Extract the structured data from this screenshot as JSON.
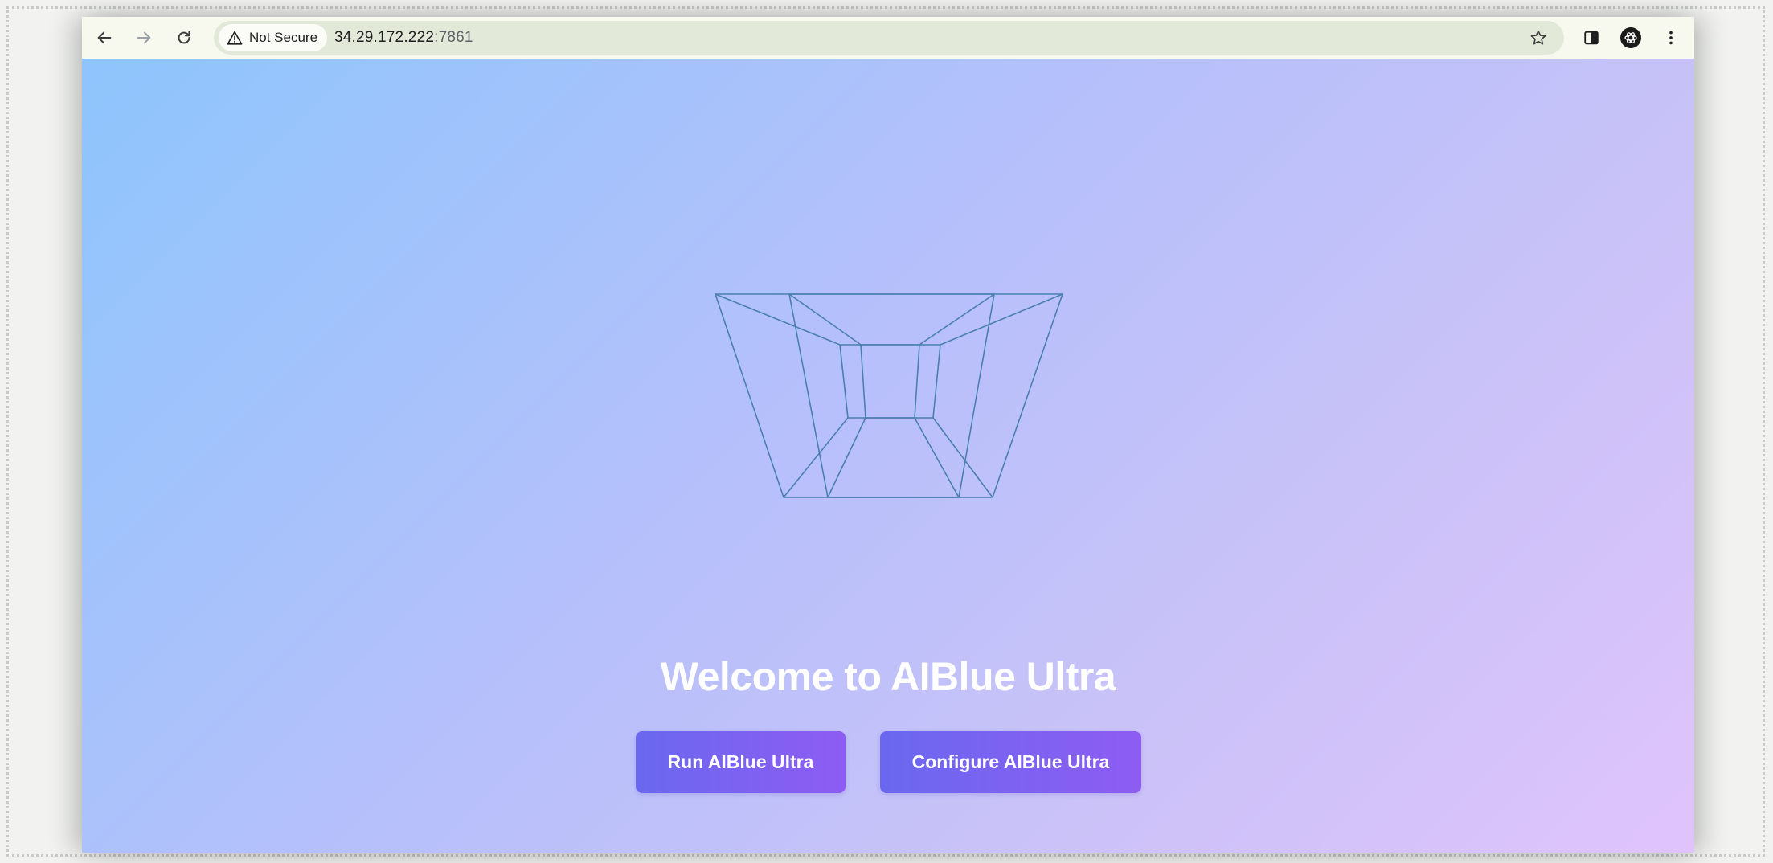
{
  "browser": {
    "security_label": "Not Secure",
    "url_host": "34.29.172.222",
    "url_port": ":7861",
    "icons": {
      "back": "arrow-left-icon",
      "forward": "arrow-right-icon",
      "reload": "reload-icon",
      "warning": "warning-triangle-icon",
      "bookmark": "star-icon",
      "side_panel": "side-panel-icon",
      "extension": "extension-icon",
      "menu": "kebab-menu-icon"
    }
  },
  "page": {
    "title": "Welcome to AIBlue Ultra",
    "run_button": "Run AIBlue Ultra",
    "configure_button": "Configure AIBlue Ultra",
    "colors": {
      "gradient_start": "#8ec5fc",
      "gradient_end": "#e0c3fc",
      "button_start": "#6a68ef",
      "button_end": "#8e5cf2",
      "wireframe": "#4a7fb0"
    }
  }
}
